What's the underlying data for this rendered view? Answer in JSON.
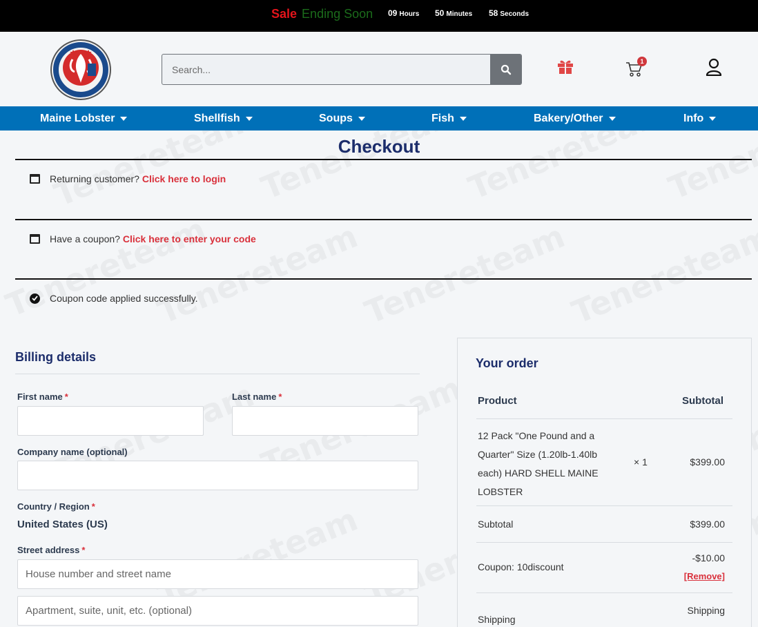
{
  "promo": {
    "sale": "Sale",
    "ending": "Ending Soon",
    "hours_value": "09",
    "hours_unit": "Hours",
    "minutes_value": "50",
    "minutes_unit": "Minutes",
    "seconds_value": "58",
    "seconds_unit": "Seconds"
  },
  "header": {
    "logo_text": "LOBSTERORDER.COM",
    "search_placeholder": "Search...",
    "cart_count": "1"
  },
  "nav": {
    "items": [
      {
        "label": "Maine Lobster"
      },
      {
        "label": "Shellfish"
      },
      {
        "label": "Soups"
      },
      {
        "label": "Fish"
      },
      {
        "label": "Bakery/Other"
      },
      {
        "label": "Info"
      }
    ]
  },
  "page": {
    "title": "Checkout"
  },
  "notices": {
    "returning_text": "Returning customer?",
    "returning_link": "Click here to login",
    "coupon_text": "Have a coupon?",
    "coupon_link": "Click here to enter your code",
    "applied_text": "Coupon code applied successfully."
  },
  "billing": {
    "title": "Billing details",
    "first_name_label": "First name",
    "last_name_label": "Last name",
    "company_label": "Company name (optional)",
    "country_label": "Country / Region",
    "country_value": "United States (US)",
    "street_label": "Street address",
    "street_placeholder": "House number and street name",
    "apt_placeholder": "Apartment, suite, unit, etc. (optional)",
    "required_mark": "*"
  },
  "order": {
    "title": "Your order",
    "col_product": "Product",
    "col_subtotal": "Subtotal",
    "product_name": "12 Pack \"One Pound and a Quarter\" Size (1.20lb-1.40lb each) HARD SHELL MAINE LOBSTER",
    "product_qty": "× 1",
    "product_price": "$399.00",
    "subtotal_label": "Subtotal",
    "subtotal_value": "$399.00",
    "coupon_label": "Coupon: 10discount",
    "coupon_value": "-$10.00",
    "coupon_remove": "[Remove]",
    "shipping_label": "Shipping",
    "shipping_value": "Shipping"
  },
  "watermark": "Tenereteam",
  "colors": {
    "nav_blue": "#0070b8",
    "heading_navy": "#1c2d6b",
    "link_red": "#d9303b",
    "sale_red": "#e3141b",
    "sale_green": "#1b6b1b"
  }
}
